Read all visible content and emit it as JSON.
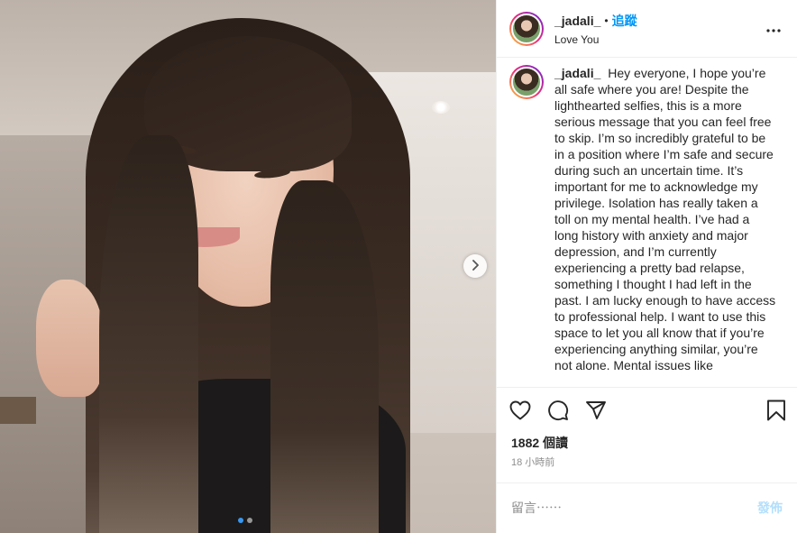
{
  "post": {
    "username": "_jadali_",
    "separator": "•",
    "follow_label": "追蹤",
    "location": "Love You",
    "caption": "Hey everyone, I hope you’re all safe where you are! Despite the lighthearted selfies, this is a more serious message that you can feel free to skip. I’m so incredibly grateful to be in a position where I’m safe and secure during such an uncertain time. It’s important for me to acknowledge my privilege. Isolation has really taken a toll on my mental health. I’ve had a long history with anxiety and major depression, and I’m currently experiencing a pretty bad relapse, something I thought I had left in the past. I am lucky enough to have access to professional help. I want to use this space to let you all know that if you’re experiencing anything similar, you’re not alone. Mental issues like",
    "views": "1882 個讀",
    "time": "18 小時前",
    "carousel": {
      "slide": 1,
      "slides": 2
    }
  },
  "comment": {
    "placeholder": "留言⋯⋯",
    "post_label": "發佈"
  },
  "icons": {
    "more": "more-options-icon",
    "next": "chevron-right-icon",
    "like": "heart-icon",
    "comment": "comment-icon",
    "share": "paper-plane-icon",
    "save": "bookmark-icon"
  },
  "colors": {
    "follow_blue": "#0095f6",
    "post_button_disabled": "#b2dffc",
    "secondary_text": "#8e8e8e",
    "border": "#efefef"
  }
}
